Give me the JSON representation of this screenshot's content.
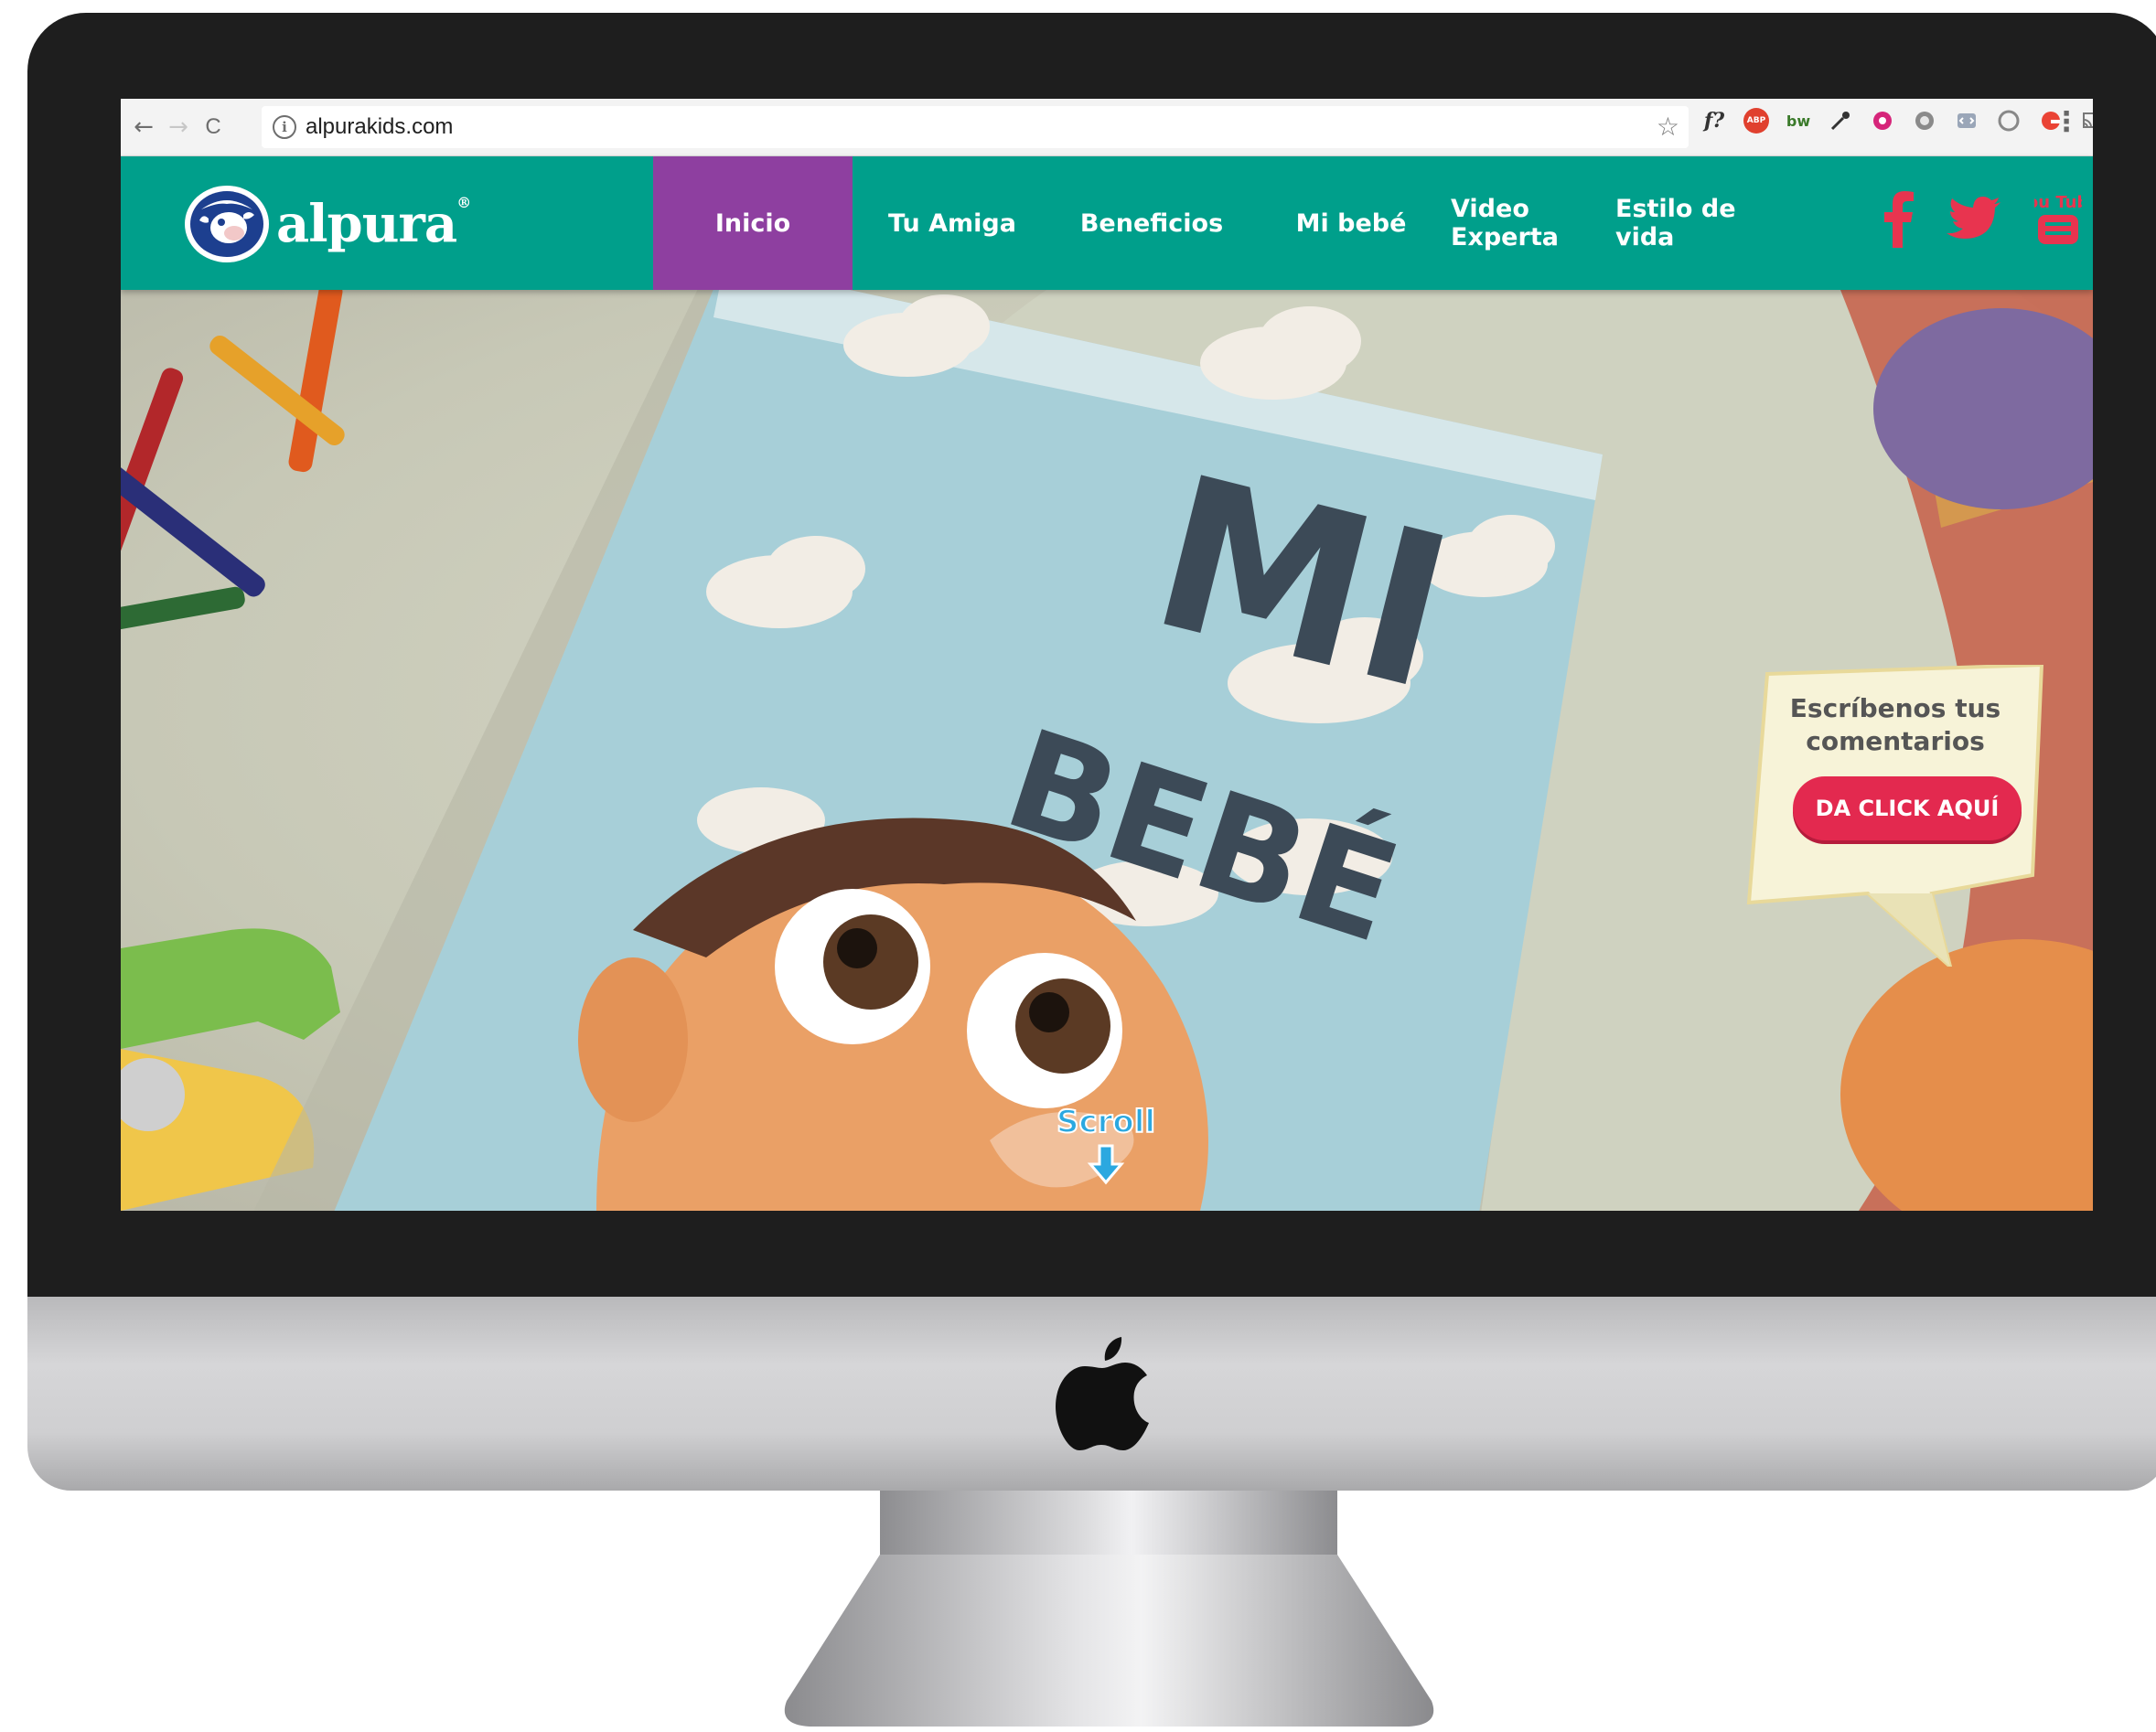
{
  "browser": {
    "url": "alpurakids.com",
    "nav_back": "←",
    "nav_forward": "→",
    "nav_reload": "C",
    "info_icon": "i",
    "star": "☆",
    "menu": "⋮",
    "extensions": [
      "f?",
      "ABP",
      "bw",
      "eyedropper",
      "opera",
      "puzzle",
      "code",
      "circle",
      "google",
      "cast"
    ]
  },
  "site": {
    "logo_text": "alpura",
    "logo_mark": "®",
    "nav": {
      "inicio": "Inicio",
      "tu_amiga": "Tu Amiga",
      "beneficios": "Beneficios",
      "mi_bebe": "Mi bebé",
      "video_experta": "Video Experta",
      "estilo_de_vida": "Estilo de vida"
    },
    "social_icons": [
      "facebook-icon",
      "twitter-icon",
      "youtube-icon"
    ],
    "youtube_label": "You Tube",
    "colors": {
      "header": "#009f8b",
      "active_nav": "#8e3fa0",
      "cta": "#e3294f"
    }
  },
  "hero": {
    "book_title_line1": "MI",
    "book_title_line2": "BEBÉ",
    "comments_line1": "Escríbenos tus",
    "comments_line2": "comentarios",
    "comments_button": "DA CLICK AQUÍ",
    "scroll_label": "Scroll"
  }
}
